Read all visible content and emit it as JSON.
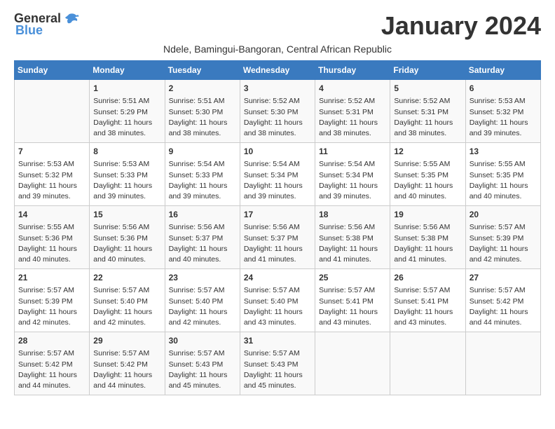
{
  "header": {
    "logo_general": "General",
    "logo_blue": "Blue",
    "month_title": "January 2024",
    "subtitle": "Ndele, Bamingui-Bangoran, Central African Republic"
  },
  "calendar": {
    "days_of_week": [
      "Sunday",
      "Monday",
      "Tuesday",
      "Wednesday",
      "Thursday",
      "Friday",
      "Saturday"
    ],
    "weeks": [
      [
        {
          "day": "",
          "info": ""
        },
        {
          "day": "1",
          "info": "Sunrise: 5:51 AM\nSunset: 5:29 PM\nDaylight: 11 hours and 38 minutes."
        },
        {
          "day": "2",
          "info": "Sunrise: 5:51 AM\nSunset: 5:30 PM\nDaylight: 11 hours and 38 minutes."
        },
        {
          "day": "3",
          "info": "Sunrise: 5:52 AM\nSunset: 5:30 PM\nDaylight: 11 hours and 38 minutes."
        },
        {
          "day": "4",
          "info": "Sunrise: 5:52 AM\nSunset: 5:31 PM\nDaylight: 11 hours and 38 minutes."
        },
        {
          "day": "5",
          "info": "Sunrise: 5:52 AM\nSunset: 5:31 PM\nDaylight: 11 hours and 38 minutes."
        },
        {
          "day": "6",
          "info": "Sunrise: 5:53 AM\nSunset: 5:32 PM\nDaylight: 11 hours and 39 minutes."
        }
      ],
      [
        {
          "day": "7",
          "info": "Sunrise: 5:53 AM\nSunset: 5:32 PM\nDaylight: 11 hours and 39 minutes."
        },
        {
          "day": "8",
          "info": "Sunrise: 5:53 AM\nSunset: 5:33 PM\nDaylight: 11 hours and 39 minutes."
        },
        {
          "day": "9",
          "info": "Sunrise: 5:54 AM\nSunset: 5:33 PM\nDaylight: 11 hours and 39 minutes."
        },
        {
          "day": "10",
          "info": "Sunrise: 5:54 AM\nSunset: 5:34 PM\nDaylight: 11 hours and 39 minutes."
        },
        {
          "day": "11",
          "info": "Sunrise: 5:54 AM\nSunset: 5:34 PM\nDaylight: 11 hours and 39 minutes."
        },
        {
          "day": "12",
          "info": "Sunrise: 5:55 AM\nSunset: 5:35 PM\nDaylight: 11 hours and 40 minutes."
        },
        {
          "day": "13",
          "info": "Sunrise: 5:55 AM\nSunset: 5:35 PM\nDaylight: 11 hours and 40 minutes."
        }
      ],
      [
        {
          "day": "14",
          "info": "Sunrise: 5:55 AM\nSunset: 5:36 PM\nDaylight: 11 hours and 40 minutes."
        },
        {
          "day": "15",
          "info": "Sunrise: 5:56 AM\nSunset: 5:36 PM\nDaylight: 11 hours and 40 minutes."
        },
        {
          "day": "16",
          "info": "Sunrise: 5:56 AM\nSunset: 5:37 PM\nDaylight: 11 hours and 40 minutes."
        },
        {
          "day": "17",
          "info": "Sunrise: 5:56 AM\nSunset: 5:37 PM\nDaylight: 11 hours and 41 minutes."
        },
        {
          "day": "18",
          "info": "Sunrise: 5:56 AM\nSunset: 5:38 PM\nDaylight: 11 hours and 41 minutes."
        },
        {
          "day": "19",
          "info": "Sunrise: 5:56 AM\nSunset: 5:38 PM\nDaylight: 11 hours and 41 minutes."
        },
        {
          "day": "20",
          "info": "Sunrise: 5:57 AM\nSunset: 5:39 PM\nDaylight: 11 hours and 42 minutes."
        }
      ],
      [
        {
          "day": "21",
          "info": "Sunrise: 5:57 AM\nSunset: 5:39 PM\nDaylight: 11 hours and 42 minutes."
        },
        {
          "day": "22",
          "info": "Sunrise: 5:57 AM\nSunset: 5:40 PM\nDaylight: 11 hours and 42 minutes."
        },
        {
          "day": "23",
          "info": "Sunrise: 5:57 AM\nSunset: 5:40 PM\nDaylight: 11 hours and 42 minutes."
        },
        {
          "day": "24",
          "info": "Sunrise: 5:57 AM\nSunset: 5:40 PM\nDaylight: 11 hours and 43 minutes."
        },
        {
          "day": "25",
          "info": "Sunrise: 5:57 AM\nSunset: 5:41 PM\nDaylight: 11 hours and 43 minutes."
        },
        {
          "day": "26",
          "info": "Sunrise: 5:57 AM\nSunset: 5:41 PM\nDaylight: 11 hours and 43 minutes."
        },
        {
          "day": "27",
          "info": "Sunrise: 5:57 AM\nSunset: 5:42 PM\nDaylight: 11 hours and 44 minutes."
        }
      ],
      [
        {
          "day": "28",
          "info": "Sunrise: 5:57 AM\nSunset: 5:42 PM\nDaylight: 11 hours and 44 minutes."
        },
        {
          "day": "29",
          "info": "Sunrise: 5:57 AM\nSunset: 5:42 PM\nDaylight: 11 hours and 44 minutes."
        },
        {
          "day": "30",
          "info": "Sunrise: 5:57 AM\nSunset: 5:43 PM\nDaylight: 11 hours and 45 minutes."
        },
        {
          "day": "31",
          "info": "Sunrise: 5:57 AM\nSunset: 5:43 PM\nDaylight: 11 hours and 45 minutes."
        },
        {
          "day": "",
          "info": ""
        },
        {
          "day": "",
          "info": ""
        },
        {
          "day": "",
          "info": ""
        }
      ]
    ]
  }
}
